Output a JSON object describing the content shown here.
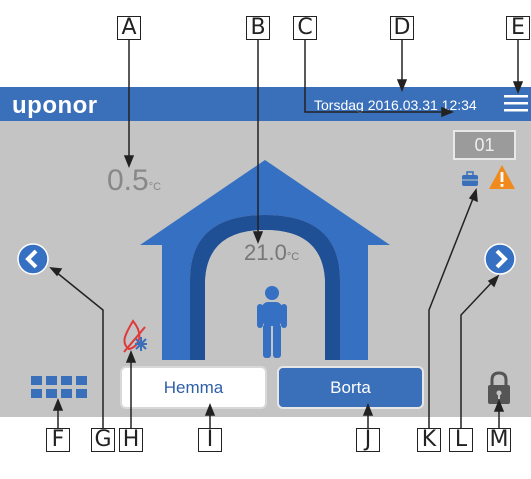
{
  "header": {
    "brand": "uponor",
    "datetime": "Torsdag 2016.03.31 12:34"
  },
  "main": {
    "outdoor_temp": "0.5",
    "indoor_temp": "21.0",
    "temp_unit": "°C",
    "zone_number": "01"
  },
  "mode_buttons": {
    "home_label": "Hemma",
    "away_label": "Borta"
  },
  "callouts": {
    "A": "A",
    "B": "B",
    "C": "C",
    "D": "D",
    "E": "E",
    "F": "F",
    "G": "G",
    "H": "H",
    "I": "I",
    "J": "J",
    "K": "K",
    "L": "L",
    "M": "M"
  },
  "colors": {
    "brand_blue": "#3a6fba",
    "house_blue": "#3570c2",
    "warning_orange": "#f08a1c",
    "screen_grey": "#c4c4c4"
  },
  "icons": {
    "menu": "hamburger-menu-icon",
    "prev": "chevron-left-icon",
    "next": "chevron-right-icon",
    "grid": "grid-icon",
    "lock": "padlock-icon",
    "warning": "warning-triangle-icon",
    "eco": "suitcase-icon",
    "heat_cool": "flame-snowflake-icon",
    "person": "person-icon"
  }
}
